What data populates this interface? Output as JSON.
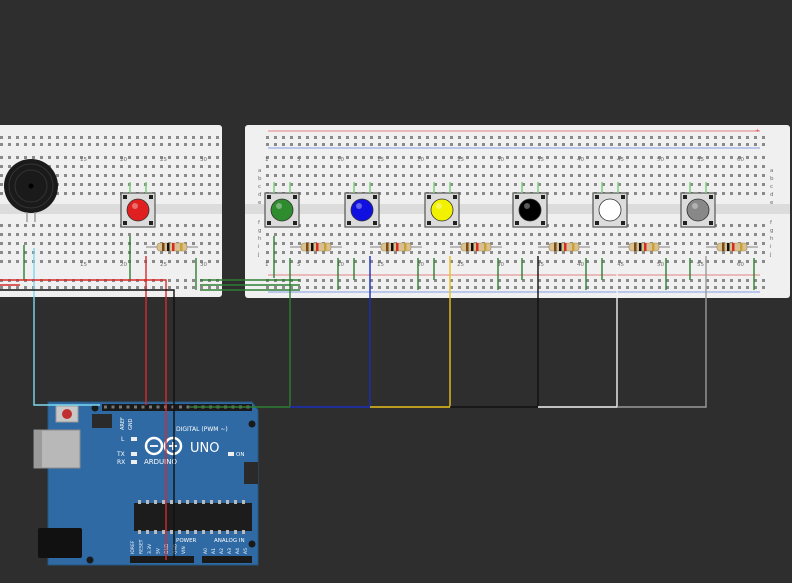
{
  "colors": {
    "background": "#2e2e2e",
    "breadboard": "#f0f0f0",
    "arduino_board": "#2f6aa4",
    "wire_red": "#d62b2b",
    "wire_black": "#111111",
    "wire_green": "#2e7d32",
    "wire_blue": "#1a2fb8",
    "wire_yellow": "#e8c21a",
    "wire_white": "#f2f2f2",
    "wire_gray": "#9a9a9a",
    "wire_cyan": "#7fd8f0"
  },
  "left_breadboard": {
    "column_numbers": [
      "15",
      "20",
      "25",
      "30"
    ],
    "buttons": [
      {
        "cap_color": "#e02020",
        "name": "red"
      }
    ]
  },
  "right_breadboard": {
    "column_numbers": [
      "1",
      "5",
      "10",
      "15",
      "20",
      "25",
      "30",
      "35",
      "40",
      "45",
      "50",
      "55",
      "60"
    ],
    "row_letters_top": [
      "a",
      "b",
      "c",
      "d",
      "e"
    ],
    "row_letters_bottom": [
      "f",
      "g",
      "h",
      "i",
      "j"
    ],
    "buttons": [
      {
        "cap_color": "#2e8b2e",
        "name": "green"
      },
      {
        "cap_color": "#1010e0",
        "name": "blue"
      },
      {
        "cap_color": "#f2f200",
        "name": "yellow"
      },
      {
        "cap_color": "#000000",
        "name": "black"
      },
      {
        "cap_color": "#ffffff",
        "name": "white"
      },
      {
        "cap_color": "#888888",
        "name": "gray"
      }
    ]
  },
  "arduino": {
    "brand": "ARDUINO",
    "model": "UNO",
    "digital_label": "DIGITAL (PWM ~)",
    "analog_label": "ANALOG IN",
    "power_label": "POWER",
    "on_label": "ON",
    "tx_label": "TX",
    "rx_label": "RX",
    "l_label": "L",
    "aref_label": "AREF",
    "gnd_label": "GND",
    "analog_pins": [
      "A0",
      "A1",
      "A2",
      "A3",
      "A4",
      "A5"
    ],
    "power_pins": [
      "IOREF",
      "RESET",
      "3.3V",
      "5V",
      "GND",
      "GND",
      "VIN"
    ]
  }
}
